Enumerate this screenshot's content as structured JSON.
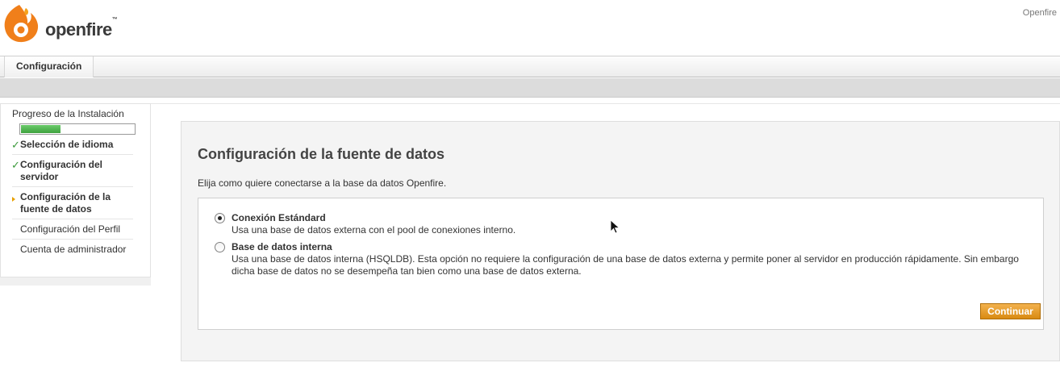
{
  "header": {
    "logo_text": "openfire",
    "logo_tm": "™",
    "top_right": "Openfire"
  },
  "nav": {
    "tabs": [
      {
        "label": "Configuración"
      }
    ]
  },
  "sidebar": {
    "title": "Progreso de la Instalación",
    "progress_percent": 35,
    "steps": [
      {
        "label": "Selección de idioma",
        "state": "done"
      },
      {
        "label": "Configuración del servidor",
        "state": "done"
      },
      {
        "label": "Configuración de la fuente de datos",
        "state": "current"
      },
      {
        "label": "Configuración del Perfil",
        "state": "pending"
      },
      {
        "label": "Cuenta de administrador",
        "state": "pending"
      }
    ]
  },
  "main": {
    "title": "Configuración de la fuente de datos",
    "description": "Elija como quiere conectarse a la base da datos Openfire.",
    "options": [
      {
        "label": "Conexión Estándard",
        "description": "Usa una base de datos externa con el pool de conexiones interno.",
        "checked": true
      },
      {
        "label": "Base de datos interna",
        "description": "Usa una base de datos interna (HSQLDB). Esta opción no requiere la configuración de una base de datos externa y permite poner al servidor en producción rápidamente. Sin embargo dicha base de datos no se desempeña tan bien como una base de datos externa.",
        "checked": false
      }
    ],
    "continue_label": "Continuar"
  },
  "icons": {
    "logo": "openfire-flame-icon",
    "check": "checkmark-icon",
    "current": "arrow-right-icon",
    "pointer": "mouse-cursor-icon"
  },
  "colors": {
    "progress": "#3ea23e",
    "button": "#e69a22",
    "check": "#3c9a3c",
    "current_arrow": "#e8a000"
  }
}
